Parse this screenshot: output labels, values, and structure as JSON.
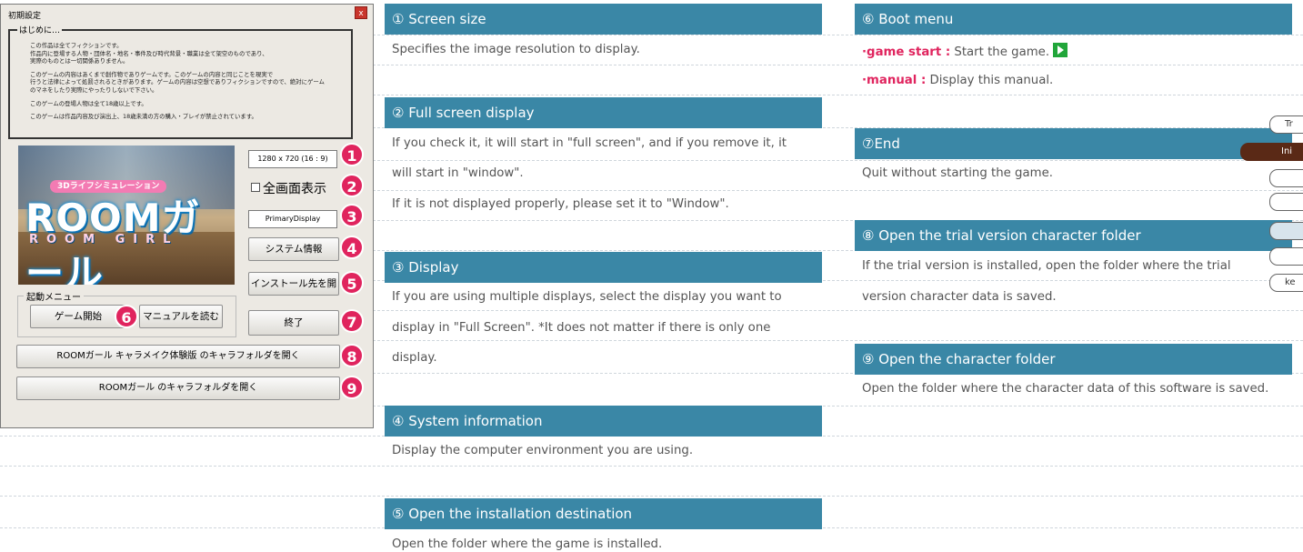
{
  "dialog": {
    "title": "初期設定",
    "close": "x",
    "intro": {
      "legend": "はじめに…",
      "paragraphs": [
        "この作品は全てフィクションです。\n作品内に登場する人物・団体名・地名・事件及び時代背景・職業は全て架空のものであり、\n実際のものとは一切関係ありません。",
        "このゲームの内容はあくまで創作物でありゲームです。このゲームの内容と同じことを現実で\n行うと法律によって処罰されるときがあります。ゲームの内容は空想でありフィクションですので、絶対にゲーム\nのマネをしたり実際にやったりしないで下さい。",
        "このゲームの登場人物は全て18歳以上です。",
        "このゲームは作品内容及び演出上、18歳未満の方の購入・プレイが禁止されています。"
      ]
    },
    "game_image": {
      "subtitle": "3Dライフシミュレーション",
      "logo": "ROOMガール",
      "logo_sub": "ROOM GIRL"
    },
    "resolution": "1280 x 720 (16 : 9)",
    "fullscreen_label": "全画面表示",
    "display_value": "PrimaryDisplay",
    "system_info": "システム情報",
    "install_folder": "インストール先を開",
    "boot_menu": {
      "legend": "起動メニュー",
      "start": "ゲーム開始",
      "manual": "マニュアルを読む"
    },
    "exit": "終了",
    "trial_folder": "ROOMガール キャラメイク体験版 のキャラフォルダを開く",
    "chara_folder": "ROOMガール のキャラフォルダを開く",
    "badges": [
      "1",
      "2",
      "3",
      "4",
      "5",
      "6",
      "7",
      "8",
      "9"
    ]
  },
  "manual": {
    "s1": {
      "head": "① Screen size",
      "lines": [
        "Specifies the image resolution to display."
      ]
    },
    "s2": {
      "head": "② Full screen display",
      "lines": [
        "If you check it, it will start in \"full screen\", and if you remove it, it",
        "will start in \"window\".",
        "If it is not displayed properly, please set it to \"Window\"."
      ]
    },
    "s3": {
      "head": "③ Display",
      "lines": [
        "If you are using multiple displays, select the display you want to",
        "display in \"Full Screen\". *It does not matter if there is only one",
        "display."
      ]
    },
    "s4": {
      "head": "④ System information",
      "lines": [
        "Display the computer environment you are using."
      ]
    },
    "s5": {
      "head": "⑤ Open the installation destination",
      "lines": [
        "Open the folder where the game is installed."
      ]
    },
    "s6": {
      "head": "⑥ Boot menu",
      "game_start_label": "·game start :",
      "game_start_text": " Start the game.",
      "manual_label": "·manual :",
      "manual_text": " Display this manual."
    },
    "s7": {
      "head": "⑦End",
      "lines": [
        "Quit without starting the game."
      ]
    },
    "s8": {
      "head": "⑧ Open the trial version character folder",
      "lines": [
        "If the trial version is installed, open the folder where the trial",
        "version character data is saved."
      ]
    },
    "s9": {
      "head": "⑨ Open the character folder",
      "lines": [
        "Open the folder where the character data of this software is saved."
      ]
    }
  },
  "side_buttons": [
    "Tr",
    "Ini",
    "",
    "",
    "",
    "",
    "ke"
  ],
  "colors": {
    "header": "#3a87a6",
    "accent": "#e0245e",
    "play": "#21a63a",
    "side_active": "#5a2916"
  }
}
